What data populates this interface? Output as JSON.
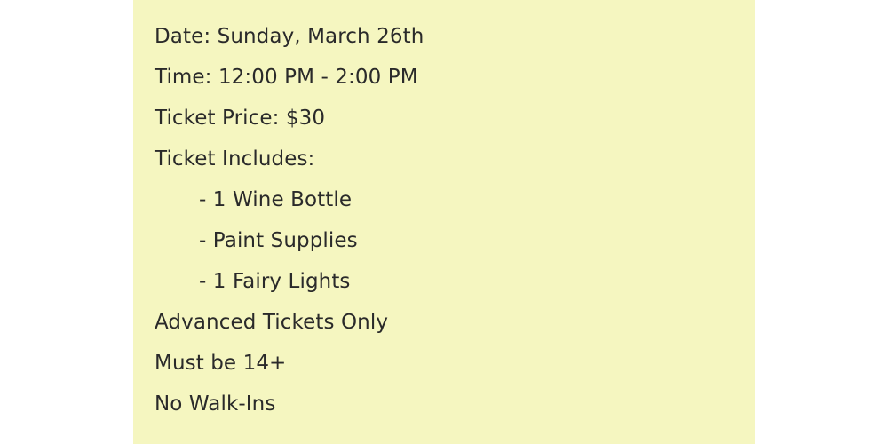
{
  "colors": {
    "panel_background": "#f5f6c0",
    "text": "#2a2a2a"
  },
  "event": {
    "date": "Date: Sunday, March 26th",
    "time": "Time: 12:00 PM - 2:00 PM",
    "price": "Ticket Price: $30",
    "includes_heading": "Ticket Includes:",
    "includes": [
      "- 1 Wine Bottle",
      "- Paint Supplies",
      "- 1 Fairy Lights"
    ],
    "notes": [
      "Advanced Tickets Only",
      "Must be 14+",
      "No Walk-Ins"
    ]
  }
}
